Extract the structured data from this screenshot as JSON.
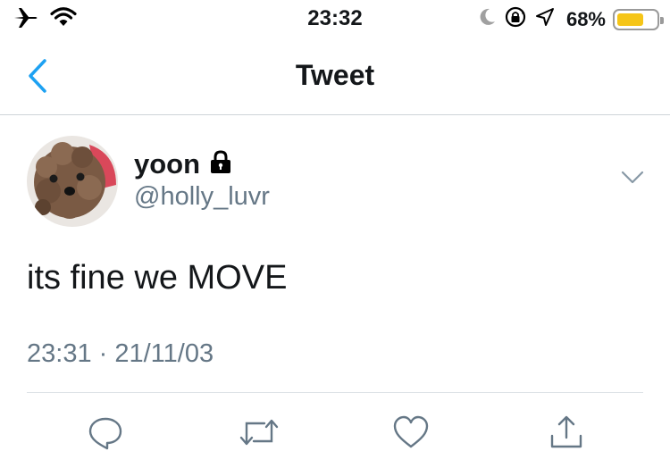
{
  "status_bar": {
    "time": "23:32",
    "battery_percent": "68%",
    "battery_level": 0.68,
    "battery_color": "#f5c518",
    "icons": [
      "airplane-icon",
      "wifi-icon",
      "moon-icon",
      "orientation-lock-icon",
      "location-icon",
      "battery-icon"
    ]
  },
  "nav": {
    "title": "Tweet",
    "back_icon": "chevron-left-icon",
    "accent_color": "#1da1f2"
  },
  "tweet": {
    "display_name": "yoon",
    "protected_icon": "lock-icon",
    "handle": "@holly_luvr",
    "text": "its fine we MOVE",
    "timestamp": "23:31 · 21/11/03",
    "avatar": "dog-avatar"
  },
  "actions": [
    {
      "icon": "reply-icon"
    },
    {
      "icon": "retweet-icon"
    },
    {
      "icon": "like-icon"
    },
    {
      "icon": "share-icon"
    }
  ]
}
